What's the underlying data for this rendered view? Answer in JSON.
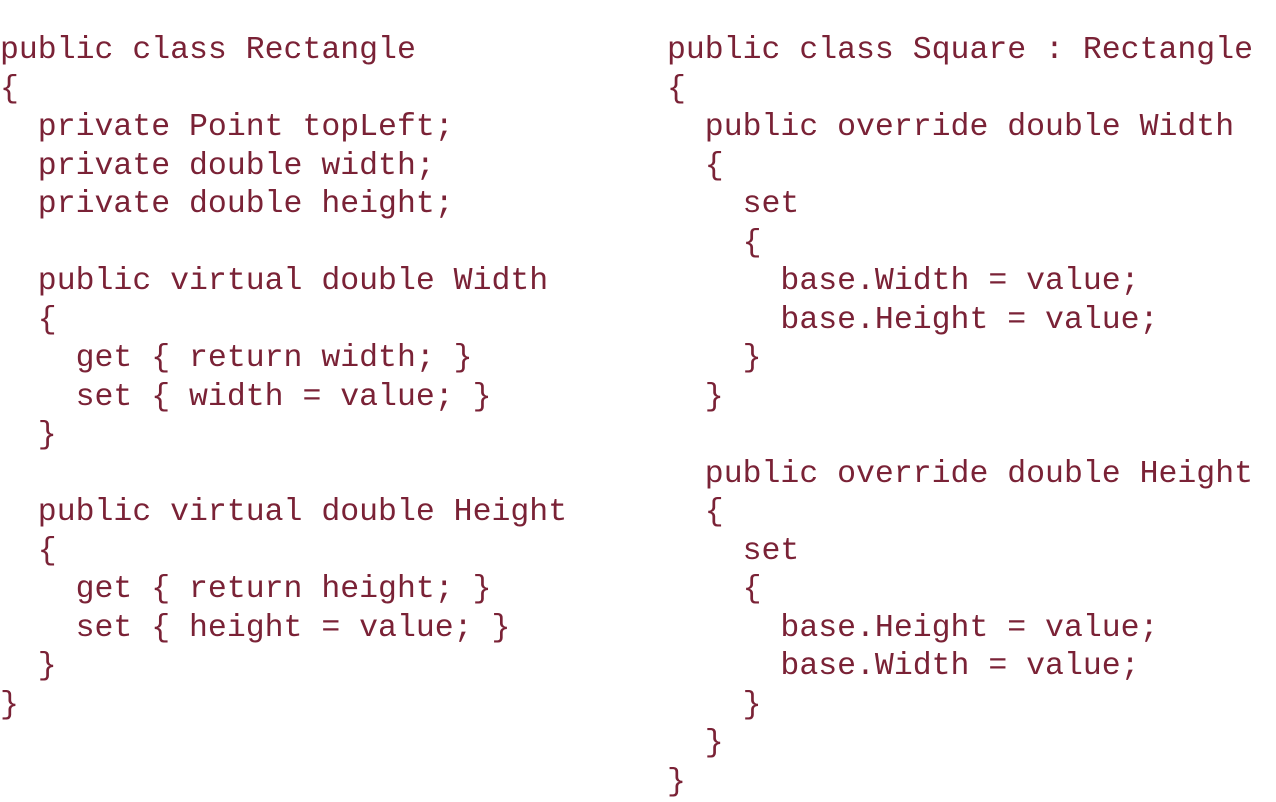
{
  "text_color": "#7a2236",
  "background": "#ffffff",
  "left_block": {
    "lines": [
      "public class Rectangle",
      "{",
      "  private Point topLeft;",
      "  private double width;",
      "  private double height;",
      "",
      "  public virtual double Width",
      "  {",
      "    get { return width; }",
      "    set { width = value; }",
      "  }",
      "",
      "  public virtual double Height",
      "  {",
      "    get { return height; }",
      "    set { height = value; }",
      "  }",
      "}"
    ]
  },
  "right_block": {
    "lines": [
      "public class Square : Rectangle",
      "{",
      "  public override double Width",
      "  {",
      "    set",
      "    {",
      "      base.Width = value;",
      "      base.Height = value;",
      "    }",
      "  }",
      "",
      "  public override double Height",
      "  {",
      "    set",
      "    {",
      "      base.Height = value;",
      "      base.Width = value;",
      "    }",
      "  }",
      "}"
    ]
  }
}
